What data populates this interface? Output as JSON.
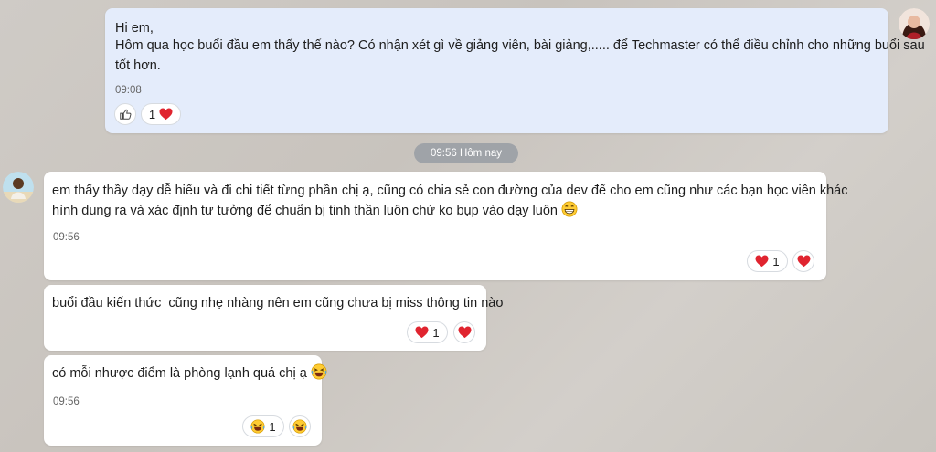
{
  "messages": {
    "m1": {
      "greeting": "Hi em,",
      "line2": "Hôm qua học buổi đầu em thấy thế nào? Có nhận xét gì về giảng viên, bài giảng,..... để Techmaster có thể điều chỉnh cho những buổi sau",
      "line3": "tốt hơn.",
      "time": "09:08",
      "reaction_count": "1"
    },
    "date_separator": "09:56 Hôm nay",
    "m2": {
      "line1": "em thấy thầy dạy dễ hiểu và đi chi tiết từng phần chị ạ, cũng có chia sẻ con đường của dev để cho em cũng như các bạn học viên khác",
      "line2": "hình dung ra và xác định tư tưởng để chuẩn bị tinh thần luôn chứ ko bụp vào dạy luôn",
      "time": "09:56",
      "reaction_count": "1"
    },
    "m3": {
      "line1": "buổi đầu kiến thức  cũng nhẹ nhàng nên em cũng chưa bị miss thông tin nào",
      "reaction_count": "1"
    },
    "m4": {
      "line1": "có mỗi nhược điểm là phòng lạnh quá chị ạ",
      "time": "09:56",
      "reaction_count": "1"
    }
  },
  "icons": {
    "like": "thumbs-up-icon",
    "heart": "heart-icon",
    "grin": "grinning-emoji",
    "laugh": "laughing-emoji"
  },
  "colors": {
    "outgoing_bubble": "#e4ecfb",
    "incoming_bubble": "#ffffff",
    "heart": "#e0242f",
    "date_chip": "#9fa3a8"
  }
}
